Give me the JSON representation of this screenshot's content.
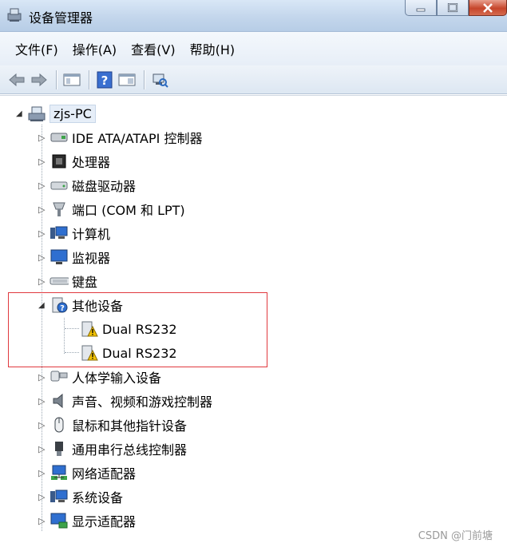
{
  "window": {
    "title": "设备管理器"
  },
  "menu": {
    "items": [
      "文件(F)",
      "操作(A)",
      "查看(V)",
      "帮助(H)"
    ]
  },
  "toolbar": {
    "buttons": [
      "back-arrow-icon",
      "forward-arrow-icon",
      "properties-panel-icon",
      "help-icon",
      "view-panel-icon",
      "scan-hardware-icon"
    ]
  },
  "tree": {
    "root": "zjs-PC",
    "categories": [
      {
        "label": "IDE ATA/ATAPI 控制器",
        "icon": "ide-controller-icon"
      },
      {
        "label": "处理器",
        "icon": "processor-icon"
      },
      {
        "label": "磁盘驱动器",
        "icon": "disk-drive-icon"
      },
      {
        "label": "端口 (COM 和 LPT)",
        "icon": "port-icon"
      },
      {
        "label": "计算机",
        "icon": "computer-icon"
      },
      {
        "label": "监视器",
        "icon": "monitor-icon"
      },
      {
        "label": "键盘",
        "icon": "keyboard-icon"
      },
      {
        "label": "其他设备",
        "icon": "other-device-icon",
        "expanded": true,
        "children": [
          "Dual RS232",
          "Dual RS232"
        ]
      },
      {
        "label": "人体学输入设备",
        "icon": "hid-icon"
      },
      {
        "label": "声音、视频和游戏控制器",
        "icon": "sound-icon"
      },
      {
        "label": "鼠标和其他指针设备",
        "icon": "mouse-icon"
      },
      {
        "label": "通用串行总线控制器",
        "icon": "usb-icon"
      },
      {
        "label": "网络适配器",
        "icon": "network-adapter-icon"
      },
      {
        "label": "系统设备",
        "icon": "system-device-icon"
      },
      {
        "label": "显示适配器",
        "icon": "display-adapter-icon"
      }
    ]
  },
  "watermark": "CSDN @门前塘",
  "colors": {
    "highlight_box": "#e0393e",
    "warning": "#f2c200"
  }
}
